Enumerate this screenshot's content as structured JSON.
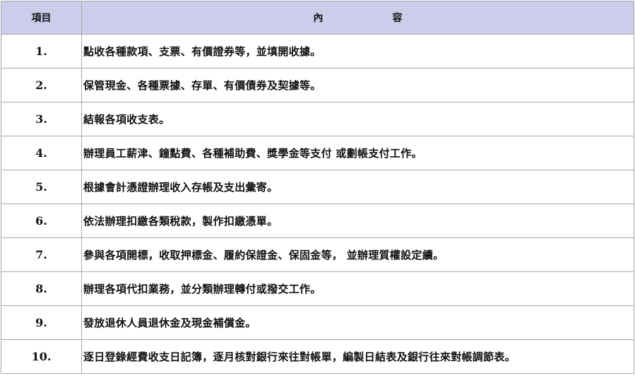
{
  "table": {
    "header": {
      "item": "項目",
      "content_chars": [
        "內",
        "容"
      ]
    },
    "rows": [
      {
        "num": "1.",
        "text": "點收各種款項、支票、有價證券等，並填開收據。"
      },
      {
        "num": "2.",
        "text": "保管現金、各種票據、存單、有價債券及契據等。"
      },
      {
        "num": "3.",
        "text": "結報各項收支表。"
      },
      {
        "num": "4.",
        "text": "辦理員工薪津、鐘點費、各種補助費、獎學金等支付 或劃帳支付工作。"
      },
      {
        "num": "5.",
        "text": "根據會計憑證辦理收入存帳及支出彙寄。"
      },
      {
        "num": "6.",
        "text": "依法辦理扣繳各類稅款，製作扣繳憑單。"
      },
      {
        "num": "7.",
        "text": "參與各項開標，收取押標金、履約保證金、保固金等， 並辦理質權設定續。"
      },
      {
        "num": "8.",
        "text": "辦理各項代扣業務，並分類辦理轉付或撥交工作。"
      },
      {
        "num": "9.",
        "text": "發放退休人員退休金及現金補償金。"
      },
      {
        "num": "10.",
        "text": "逐日登錄經費收支日記簿，逐月核對銀行來往對帳單，編製日結表及銀行往來對帳調節表。"
      }
    ]
  }
}
